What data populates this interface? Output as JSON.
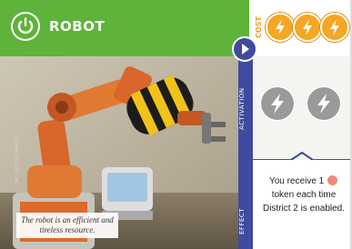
{
  "card": {
    "title": "ROBOT",
    "cost_label": "COST",
    "cost_tokens": [
      "lightning-icon",
      "lightning-icon",
      "lightning-icon"
    ],
    "activation_label": "ACTIVATION",
    "activation_tokens": [
      "lightning-icon",
      "lightning-icon"
    ],
    "effect_label": "EFFECT",
    "effect_text_before": "You receive 1",
    "effect_text_after": "token each time District 2 is enabled.",
    "caption": "The robot is an efficient and tireless resource.",
    "credit": "IMG: SP5 2015 1996 00"
  },
  "colors": {
    "header": "#5fb33a",
    "cost_token": "#f5a623",
    "side_strip": "#3f4aa0",
    "activation_token": "#9a9a9a",
    "effect_token": "#f08a78"
  }
}
